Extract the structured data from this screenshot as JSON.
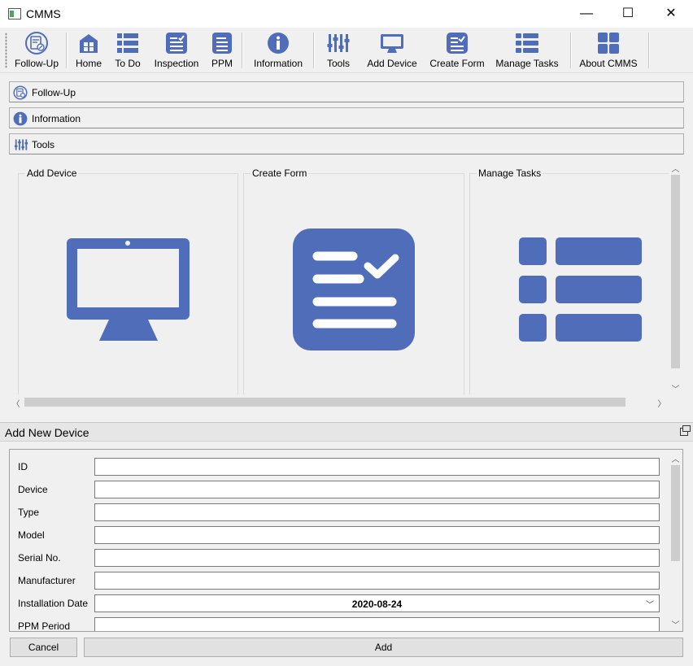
{
  "window": {
    "title": "CMMS",
    "minimize": "—",
    "maximize": "☐",
    "close": "✕"
  },
  "toolbar": {
    "items": [
      {
        "label": "Follow-Up",
        "icon": "follow-up-icon"
      },
      {
        "label": "Home",
        "icon": "home-icon"
      },
      {
        "label": "To Do",
        "icon": "list-icon"
      },
      {
        "label": "Inspection",
        "icon": "checklist-icon"
      },
      {
        "label": "PPM",
        "icon": "document-icon"
      },
      {
        "label": "Information",
        "icon": "info-icon"
      },
      {
        "label": "Tools",
        "icon": "tools-icon"
      },
      {
        "label": "Add Device",
        "icon": "monitor-icon"
      },
      {
        "label": "Create Form",
        "icon": "form-icon"
      },
      {
        "label": "Manage Tasks",
        "icon": "tasks-icon"
      },
      {
        "label": "About CMMS",
        "icon": "grid-icon"
      }
    ]
  },
  "accordion": {
    "sections": [
      {
        "label": "Follow-Up",
        "icon": "follow-up-icon"
      },
      {
        "label": "Information",
        "icon": "info-icon"
      },
      {
        "label": "Tools",
        "icon": "tools-icon"
      }
    ]
  },
  "tools": {
    "groups": [
      {
        "title": "Add Device",
        "icon": "monitor-icon"
      },
      {
        "title": "Create Form",
        "icon": "form-icon"
      },
      {
        "title": "Manage Tasks",
        "icon": "tasks-icon"
      }
    ]
  },
  "dock": {
    "title": "Add New Device"
  },
  "form": {
    "fields": [
      {
        "label": "ID",
        "value": ""
      },
      {
        "label": "Device",
        "value": ""
      },
      {
        "label": "Type",
        "value": ""
      },
      {
        "label": "Model",
        "value": ""
      },
      {
        "label": "Serial No.",
        "value": ""
      },
      {
        "label": "Manufacturer",
        "value": ""
      },
      {
        "label": "Installation Date",
        "value": "2020-08-24"
      },
      {
        "label": "PPM Period",
        "value": ""
      }
    ],
    "cancel_label": "Cancel",
    "add_label": "Add"
  },
  "colors": {
    "icon_blue": "#4f6db8"
  }
}
